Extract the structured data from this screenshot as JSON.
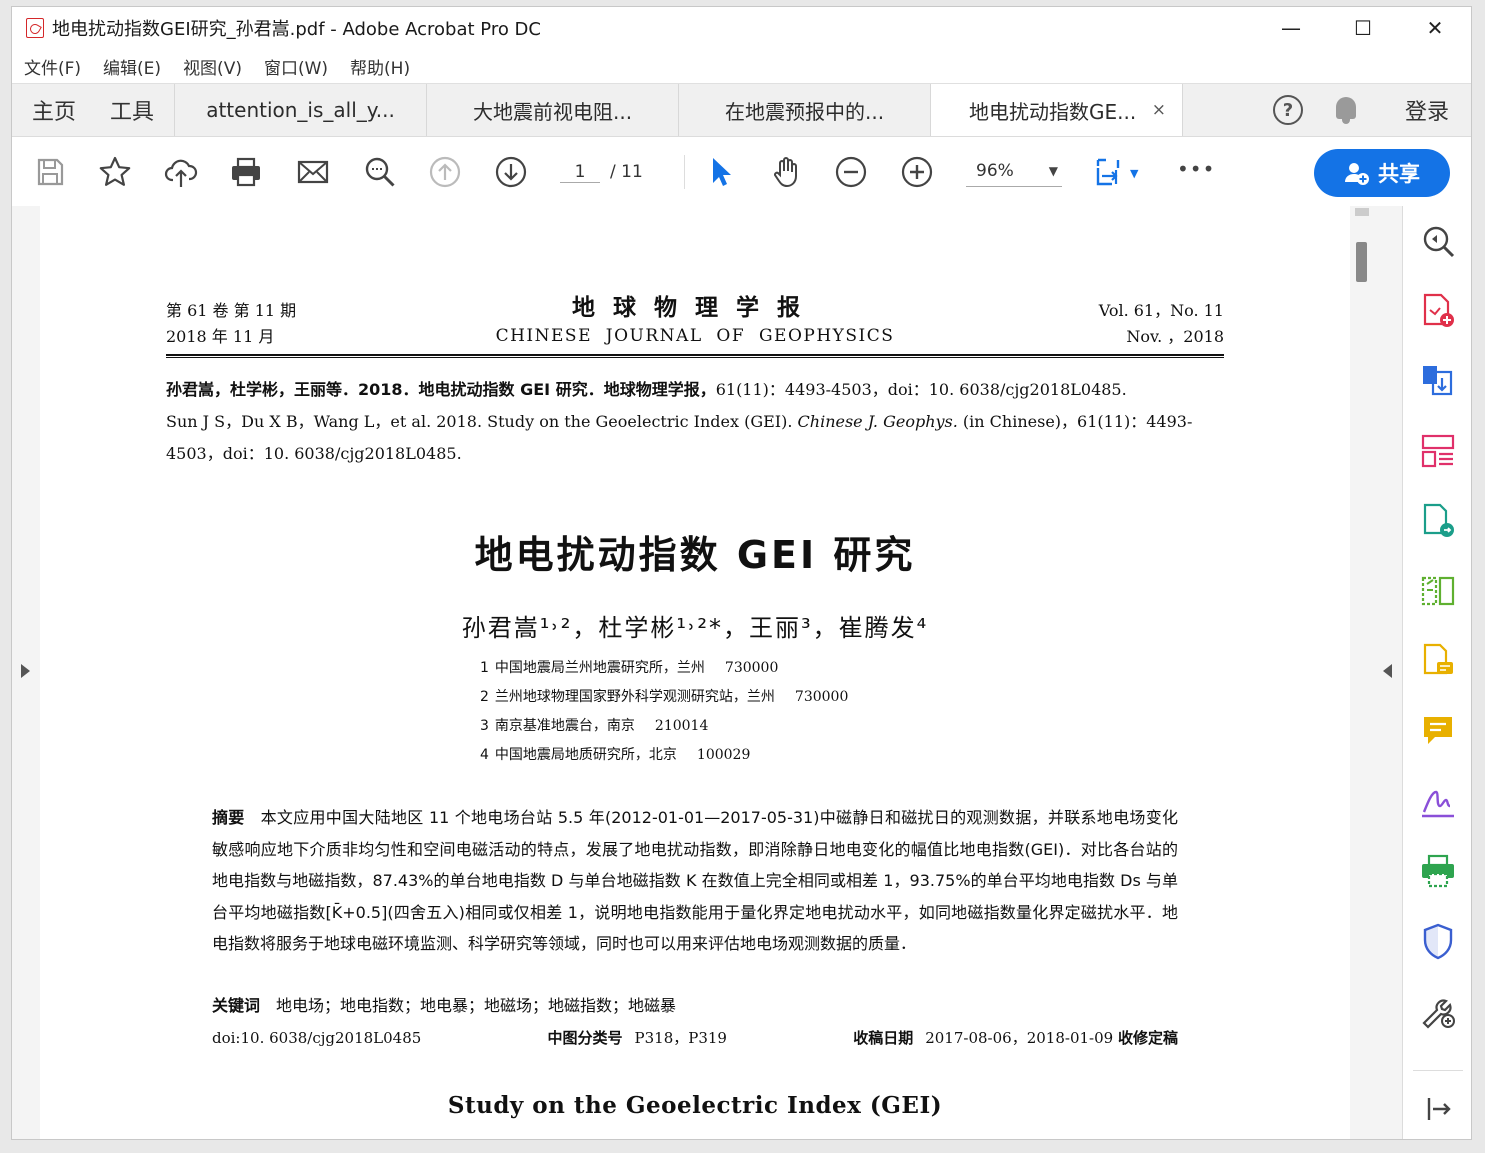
{
  "window": {
    "title": "地电扰动指数GEI研究_孙君嵩.pdf - Adobe Acrobat Pro DC",
    "minimize": "—",
    "maximize": "☐",
    "close": "✕"
  },
  "menu": [
    "文件(F)",
    "编辑(E)",
    "视图(V)",
    "窗口(W)",
    "帮助(H)"
  ],
  "tabs": {
    "home": "主页",
    "tools": "工具",
    "docs": [
      "attention_is_all_y...",
      "大地震前视电阻...",
      "在地震预报中的...",
      "地电扰动指数GE..."
    ],
    "close": "×",
    "help": "?",
    "login": "登录"
  },
  "toolbar": {
    "page_current": "1",
    "page_total": "/ 11",
    "zoom": "96%",
    "share": "共享",
    "more": "•••"
  },
  "document": {
    "header_left": [
      "第 61 卷 第 11 期",
      "2018 年 11 月"
    ],
    "journal_cn": "地球物理学报",
    "journal_en": "CHINESE  JOURNAL  OF  GEOPHYSICS",
    "header_right": [
      "Vol. 61，No. 11",
      "Nov. ，2018"
    ],
    "citation_cn": "孙君嵩，杜学彬，王丽等．2018．地电扰动指数 GEI 研究．地球物理学报，",
    "citation_cn_tail": "61(11)：4493-4503，doi：10. 6038/cjg2018L0485.",
    "citation_en": "Sun J S，Du X B，Wang L，et al. 2018. Study on the Geoelectric Index (GEI). ",
    "citation_en_journal": "Chinese J. Geophys.",
    "citation_en_tail": " (in Chinese)，61(11)：4493-4503，doi：10. 6038/cjg2018L0485.",
    "title": "地电扰动指数 GEI 研究",
    "authors": "孙君嵩¹˒²，杜学彬¹˒²*，王丽³，崔腾发⁴",
    "affiliations": [
      {
        "num": "1",
        "name": "中国地震局兰州地震研究所，兰州",
        "zip": "730000"
      },
      {
        "num": "2",
        "name": "兰州地球物理国家野外科学观测研究站，兰州",
        "zip": "730000"
      },
      {
        "num": "3",
        "name": "南京基准地震台，南京",
        "zip": "210014"
      },
      {
        "num": "4",
        "name": "中国地震局地质研究所，北京",
        "zip": "100029"
      }
    ],
    "abstract_label": "摘要",
    "abstract": "本文应用中国大陆地区 11 个地电场台站 5.5 年(2012-01-01—2017-05-31)中磁静日和磁扰日的观测数据，并联系地电场变化敏感响应地下介质非均匀性和空间电磁活动的特点，发展了地电扰动指数，即消除静日地电变化的幅值比地电指数(GEI)．对比各台站的地电指数与地磁指数，87.43%的单台地电指数 D 与单台地磁指数 K 在数值上完全相同或相差 1，93.75%的单台平均地电指数 Ds 与单台平均地磁指数[K̄+0.5](四舍五入)相同或仅相差 1，说明地电指数能用于量化界定地电扰动水平，如同地磁指数量化界定磁扰水平．地电指数将服务于地球电磁环境监测、科学研究等领域，同时也可以用来评估地电场观测数据的质量．",
    "keywords_label": "关键词",
    "keywords": "地电场；地电指数；地电暴；地磁场；地磁指数；地磁暴",
    "doi": "doi:10. 6038/cjg2018L0485",
    "class_label": "中图分类号",
    "class_value": "P318，P319",
    "received_label": "收稿日期",
    "received_value": "2017-08-06，2018-01-09",
    "revised_label": "收修定稿",
    "title_en": "Study on the Geoelectric Index (GEI)"
  }
}
